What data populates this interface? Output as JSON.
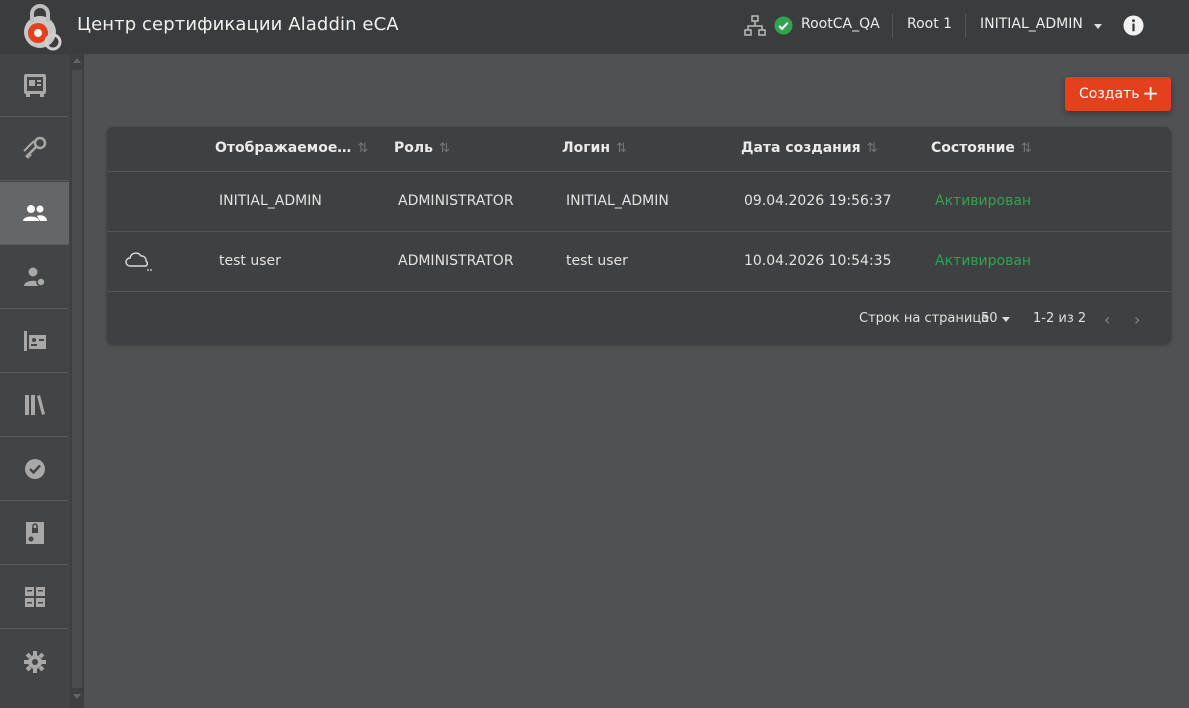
{
  "header": {
    "app_title": "Центр сертификации Aladdin eCA",
    "ca_name": "RootCA_QA",
    "ca_level": "Root 1",
    "user": "INITIAL_ADMIN",
    "colors": {
      "status_ok": "#2ea44f",
      "brand": "#e4401e"
    }
  },
  "sidebar": {
    "items": [
      {
        "icon": "safe-icon"
      },
      {
        "icon": "keys-icon"
      },
      {
        "icon": "users-icon",
        "active": true
      },
      {
        "icon": "user-certificate-icon"
      },
      {
        "icon": "contacts-icon"
      },
      {
        "icon": "library-icon"
      },
      {
        "icon": "check-seal-icon"
      },
      {
        "icon": "lock-document-icon"
      },
      {
        "icon": "grid-settings-icon"
      },
      {
        "icon": "gear-icon"
      }
    ]
  },
  "toolbar": {
    "create_label": "Создать"
  },
  "table": {
    "columns": [
      "Отображаемое…",
      "Роль",
      "Логин",
      "Дата создания",
      "Состояние"
    ],
    "rows": [
      {
        "name": "INITIAL_ADMIN",
        "role": "ADMINISTRATOR",
        "login": "INITIAL_ADMIN",
        "created": "09.04.2026 19:56:37",
        "status": "Активирован",
        "has_cloud_icon": false
      },
      {
        "name": "test user",
        "role": "ADMINISTRATOR",
        "login": "test user",
        "created": "10.04.2026 10:54:35",
        "status": "Активирован",
        "has_cloud_icon": true
      }
    ],
    "footer": {
      "rows_per_page_label": "Строк на странице",
      "rows_per_page_value": "50",
      "range": "1-2 из 2"
    }
  }
}
